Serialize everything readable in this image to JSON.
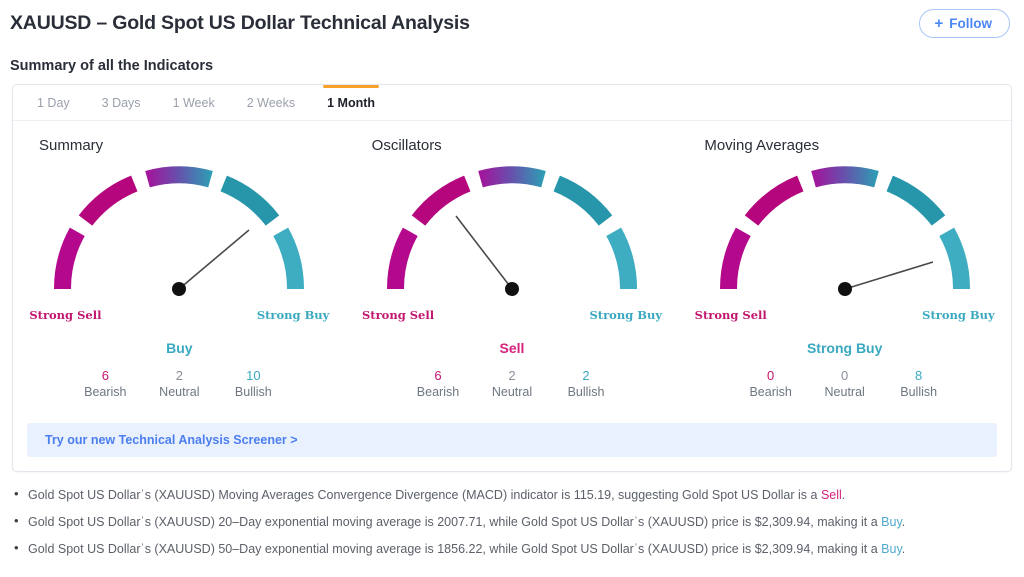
{
  "header": {
    "title": "XAUUSD – Gold Spot US Dollar Technical Analysis",
    "follow_label": "Follow",
    "follow_plus": "+"
  },
  "section": {
    "heading": "Summary of all the Indicators"
  },
  "tabs": [
    {
      "label": "1 Day",
      "active": false
    },
    {
      "label": "3 Days",
      "active": false
    },
    {
      "label": "1 Week",
      "active": false
    },
    {
      "label": "2 Weeks",
      "active": false
    },
    {
      "label": "1 Month",
      "active": true
    }
  ],
  "gauge_labels": {
    "strong_sell": "Strong Sell",
    "strong_buy": "Strong Buy",
    "bearish": "Bearish",
    "neutral": "Neutral",
    "bullish": "Bullish"
  },
  "gauges": [
    {
      "title": "Summary",
      "verdict": "Buy",
      "verdict_class": "buy",
      "needle_angle_deg": 130,
      "bearish": "6",
      "neutral": "2",
      "bullish": "10"
    },
    {
      "title": "Oscillators",
      "verdict": "Sell",
      "verdict_class": "sell",
      "needle_angle_deg": 52,
      "bearish": "6",
      "neutral": "2",
      "bullish": "2"
    },
    {
      "title": "Moving Averages",
      "verdict": "Strong Buy",
      "verdict_class": "strongbuy",
      "needle_angle_deg": 163,
      "bearish": "0",
      "neutral": "0",
      "bullish": "8"
    }
  ],
  "screener": {
    "label": "Try our new Technical Analysis Screener >"
  },
  "bullets": [
    {
      "pre": "Gold Spot US Dollarˈs (XAUUSD) Moving Averages Convergence Divergence (MACD) indicator is 115.19, suggesting Gold Spot US Dollar is a ",
      "signal": "Sell",
      "signal_class": "sell-word",
      "post": "."
    },
    {
      "pre": "Gold Spot US Dollarˈs (XAUUSD) 20–Day exponential moving average is 2007.71, while Gold Spot US Dollarˈs (XAUUSD) price is $2,309.94, making it a ",
      "signal": "Buy",
      "signal_class": "buy-word",
      "post": "."
    },
    {
      "pre": "Gold Spot US Dollarˈs (XAUUSD) 50–Day exponential moving average is 1856.22, while Gold Spot US Dollarˈs (XAUUSD) price is $2,309.94, making it a ",
      "signal": "Buy",
      "signal_class": "buy-word",
      "post": "."
    }
  ],
  "colors": {
    "strong_sell_arc": "#b4098c",
    "sell_arc": "#b5067d",
    "neutral_arc_start": "#a3159b",
    "neutral_arc_end": "#2f9cb4",
    "buy_arc": "#2796ab",
    "strong_buy_arc": "#3eadc2",
    "accent_tab": "#f7a12b",
    "link_blue": "#4b7ef0",
    "banner_bg": "#eaf1fe"
  }
}
